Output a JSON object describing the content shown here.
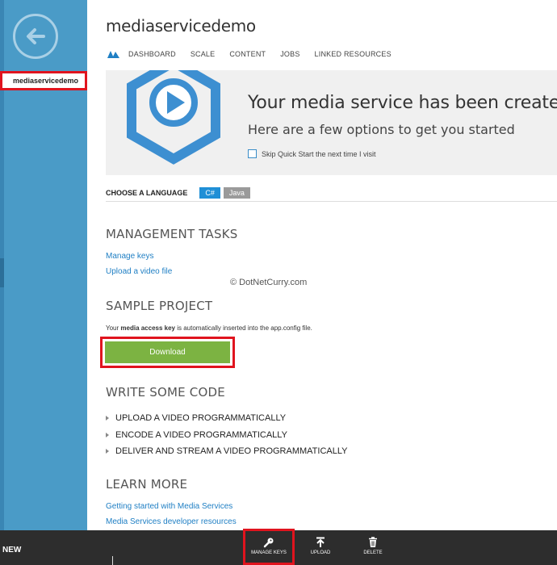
{
  "sidebar": {
    "selected_item": "mediaservicedemo",
    "back_icon": "arrow-left-circle-icon"
  },
  "header": {
    "title": "mediaservicedemo",
    "tabs": [
      "DASHBOARD",
      "SCALE",
      "CONTENT",
      "JOBS",
      "LINKED RESOURCES"
    ]
  },
  "banner": {
    "heading": "Your media service has been created!",
    "subheading": "Here are a few options to get you started",
    "skip_label": "Skip Quick Start the next time I visit"
  },
  "language": {
    "label": "CHOOSE A LANGUAGE",
    "options": [
      "C#",
      "Java"
    ],
    "selected": "C#"
  },
  "management": {
    "title": "MANAGEMENT TASKS",
    "links": [
      "Manage keys",
      "Upload a video file"
    ]
  },
  "watermark": "© DotNetCurry.com",
  "sample": {
    "title": "SAMPLE PROJECT",
    "text_before": "Your ",
    "text_bold": "media access key",
    "text_after": " is automatically inserted into the app.config file.",
    "download_label": "Download"
  },
  "code": {
    "title": "WRITE SOME CODE",
    "items": [
      "UPLOAD A VIDEO PROGRAMMATICALLY",
      "ENCODE A VIDEO PROGRAMMATICALLY",
      "DELIVER AND STREAM A VIDEO PROGRAMMATICALLY"
    ]
  },
  "learn": {
    "title": "LEARN MORE",
    "links": [
      "Getting started with Media Services",
      "Media Services developer resources"
    ]
  },
  "bottombar": {
    "new_label": "NEW",
    "actions": [
      {
        "label": "MANAGE KEYS",
        "icon": "key-icon"
      },
      {
        "label": "UPLOAD",
        "icon": "upload-icon"
      },
      {
        "label": "DELETE",
        "icon": "trash-icon"
      }
    ]
  },
  "colors": {
    "rail": "#4a9bc7",
    "accent": "#1f8fd6",
    "download": "#7cb342",
    "highlight": "#e0141e",
    "bar": "#2d2d2d"
  }
}
